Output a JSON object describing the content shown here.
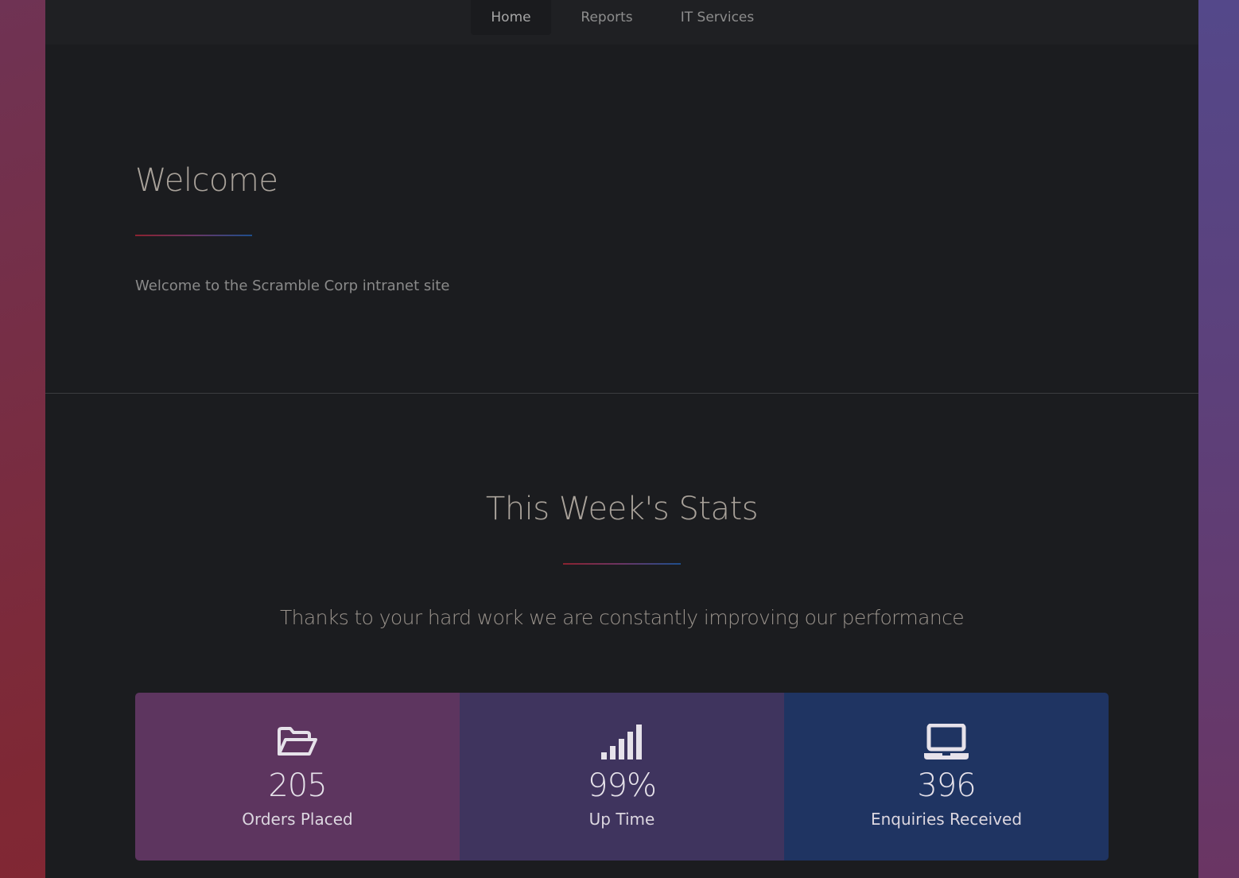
{
  "nav": {
    "items": [
      {
        "label": "Home",
        "active": true
      },
      {
        "label": "Reports",
        "active": false
      },
      {
        "label": "IT Services",
        "active": false
      }
    ]
  },
  "welcome": {
    "title": "Welcome",
    "text": "Welcome to the Scramble Corp intranet site"
  },
  "stats": {
    "title": "This Week's Stats",
    "subtitle": "Thanks to your hard work we are constantly improving our performance",
    "items": [
      {
        "icon": "folder-open-icon",
        "value": "205",
        "label": "Orders Placed",
        "color": "#5d355f"
      },
      {
        "icon": "signal-bars-icon",
        "value": "99%",
        "label": "Up Time",
        "color": "#3f345e"
      },
      {
        "icon": "laptop-icon",
        "value": "396",
        "label": "Enquiries Received",
        "color": "#1f3462"
      }
    ]
  },
  "colors": {
    "accent_red": "#8a2230",
    "accent_blue": "#1e4e8c",
    "background": "#1b1c1f"
  }
}
